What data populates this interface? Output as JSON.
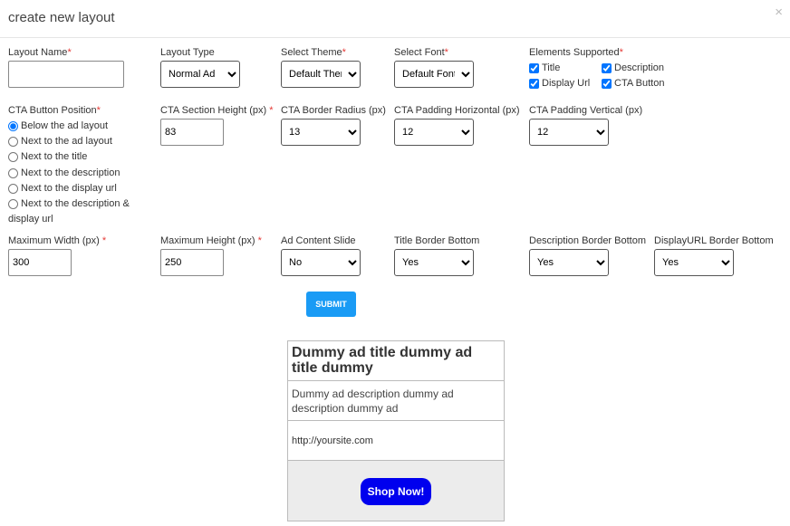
{
  "header": {
    "title": "create new layout",
    "close_glyph": "×"
  },
  "row1": {
    "layout_name": {
      "label": "Layout Name",
      "value": "",
      "placeholder": ""
    },
    "layout_type": {
      "label": "Layout Type",
      "selected": "Normal Ad"
    },
    "select_theme": {
      "label": "Select Theme",
      "selected": "Default Theme"
    },
    "select_font": {
      "label": "Select Font",
      "selected": "Default Font"
    },
    "elements_supported": {
      "label": "Elements Supported",
      "items": [
        {
          "label": "Title",
          "checked": true
        },
        {
          "label": "Description",
          "checked": true
        },
        {
          "label": "Display Url",
          "checked": true
        },
        {
          "label": "CTA Button",
          "checked": true
        }
      ]
    }
  },
  "row2": {
    "cta_button_position": {
      "label": "CTA Button Position",
      "options": [
        {
          "label": "Below the ad layout",
          "checked": true
        },
        {
          "label": "Next to the ad layout",
          "checked": false
        },
        {
          "label": "Next to the title",
          "checked": false
        },
        {
          "label": "Next to the description",
          "checked": false
        },
        {
          "label": "Next to the display url",
          "checked": false
        },
        {
          "label": "Next to the description &",
          "label2": "display url",
          "checked": false
        }
      ]
    },
    "cta_section_height": {
      "label": "CTA Section Height (px)",
      "value": "83"
    },
    "cta_border_radius": {
      "label": "CTA Border Radius (px)",
      "selected": "13"
    },
    "cta_padding_horizontal": {
      "label": "CTA Padding Horizontal (px)",
      "selected": "12"
    },
    "cta_padding_vertical": {
      "label": "CTA Padding Vertical (px)",
      "selected": "12"
    }
  },
  "row3": {
    "maximum_width": {
      "label": "Maximum Width (px)",
      "value": "300"
    },
    "maximum_height": {
      "label": "Maximum Height (px)",
      "value": "250"
    },
    "ad_content_slide": {
      "label": "Ad Content Slide",
      "selected": "No"
    },
    "title_border_bottom": {
      "label": "Title Border Bottom",
      "selected": "Yes"
    },
    "description_border_bottom": {
      "label": "Description Border Bottom",
      "selected": "Yes"
    },
    "displayurl_border_bottom": {
      "label": "DisplayURL Border Bottom",
      "selected": "Yes"
    }
  },
  "submit_label": "SUBMIT",
  "preview": {
    "title": "Dummy ad title dummy ad title dummy",
    "description": "Dummy ad description dummy ad description dummy ad",
    "display_url": "http://yoursite.com",
    "cta_label": "Shop Now!"
  },
  "colors": {
    "submit_bg": "#1a9bf5",
    "cta_bg": "#0000ee",
    "required": "#e53935",
    "cta_area_bg": "#ececec"
  },
  "required_mark": "*"
}
